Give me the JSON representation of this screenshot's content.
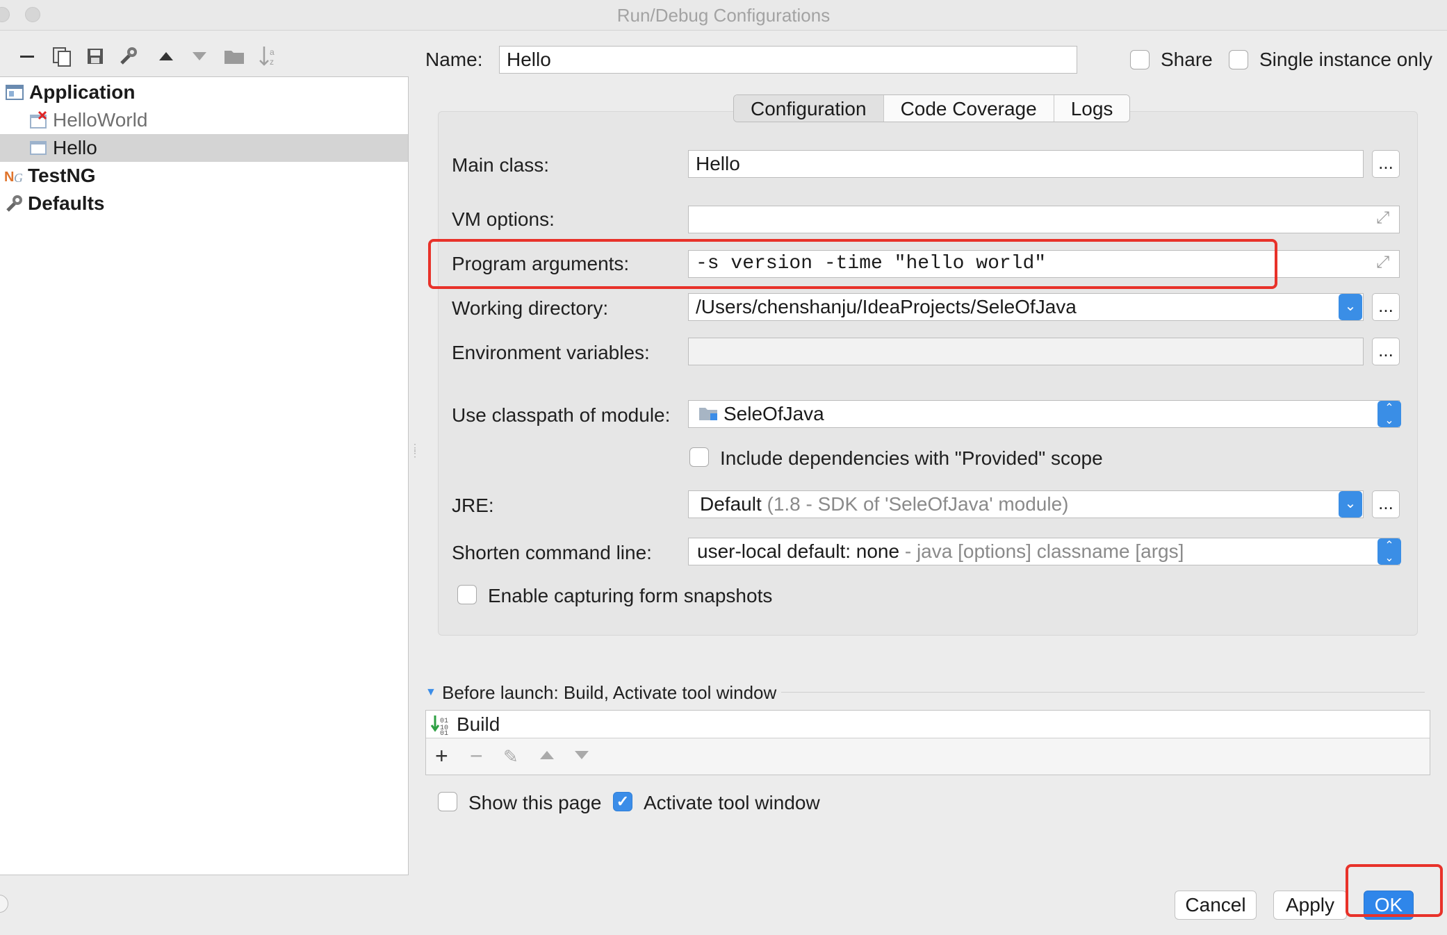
{
  "window": {
    "title": "Run/Debug Configurations"
  },
  "tree": {
    "items": [
      {
        "label": "Application",
        "icon": "application-icon",
        "bold": true
      },
      {
        "label": "HelloWorld",
        "icon": "app-config-error-icon",
        "bold": false
      },
      {
        "label": "Hello",
        "icon": "app-config-icon",
        "bold": false,
        "selected": true
      },
      {
        "label": "TestNG",
        "icon": "testng-icon",
        "bold": true
      },
      {
        "label": "Defaults",
        "icon": "wrench-icon",
        "bold": true
      }
    ]
  },
  "header": {
    "name_label": "Name:",
    "name_value": "Hello",
    "share_label": "Share",
    "single_instance_label": "Single instance only"
  },
  "tabs": [
    "Configuration",
    "Code Coverage",
    "Logs"
  ],
  "config": {
    "main_class_label": "Main class:",
    "main_class_value": "Hello",
    "vm_options_label": "VM options:",
    "vm_options_value": "",
    "program_args_label": "Program arguments:",
    "program_args_value": "-s version -time \"hello world\"",
    "working_dir_label": "Working directory:",
    "working_dir_value": "/Users/chenshanju/IdeaProjects/SeleOfJava",
    "env_vars_label": "Environment variables:",
    "env_vars_value": "",
    "classpath_label": "Use classpath of module:",
    "classpath_value": "SeleOfJava",
    "include_deps_label": "Include dependencies with \"Provided\" scope",
    "jre_label": "JRE:",
    "jre_value": "Default",
    "jre_hint": "(1.8 - SDK of 'SeleOfJava' module)",
    "shorten_label": "Shorten command line:",
    "shorten_value": "user-local default: none",
    "shorten_hint": "- java [options] classname [args]",
    "enable_capture_label": "Enable capturing form snapshots",
    "dots": "..."
  },
  "before_launch": {
    "title": "Before launch: Build, Activate tool window",
    "items": [
      "Build"
    ]
  },
  "footer": {
    "show_page_label": "Show this page",
    "activate_tool_label": "Activate tool window",
    "cancel_label": "Cancel",
    "apply_label": "Apply",
    "ok_label": "OK"
  },
  "colors": {
    "accent": "#2f86ea",
    "highlight": "#e8322a"
  }
}
